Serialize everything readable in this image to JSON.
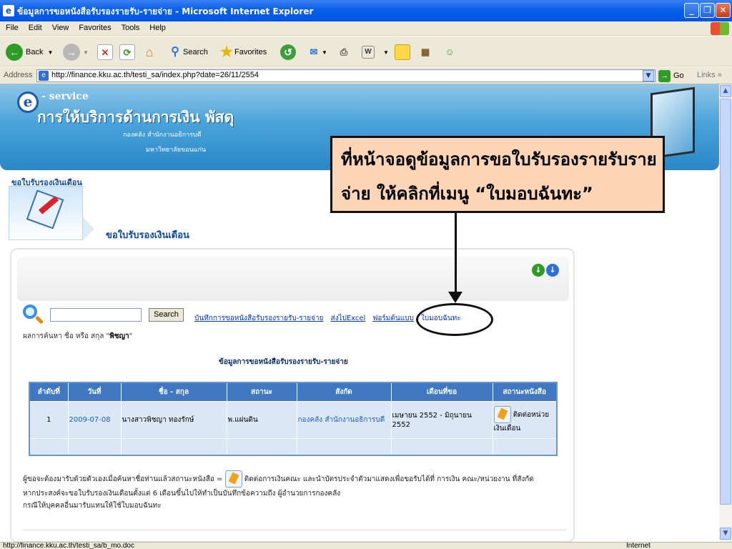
{
  "window": {
    "title": "ข้อมูลการขอหนังสือรับรองรายรับ-รายจ่าย - Microsoft Internet Explorer",
    "minimize": "_",
    "maximize": "❐",
    "close": "✕"
  },
  "menu": [
    "File",
    "Edit",
    "View",
    "Favorites",
    "Tools",
    "Help"
  ],
  "toolbar": {
    "back": "Back",
    "search": "Search",
    "favorites": "Favorites"
  },
  "address": {
    "label": "Address",
    "url": "http://finance.kku.ac.th/testi_sa/index.php?date=26/11/2554",
    "go": "Go",
    "links": "Links"
  },
  "banner": {
    "service": "- service",
    "title": "การให้บริการด้านการเงิน พัสดุ",
    "line2": "กองคลัง สำนักงานอธิการบดี",
    "line3": "มหาวิทยาลัยขอนแก่น"
  },
  "section": {
    "header": "ขอใบรับรองเงินเดือน",
    "subtitle": "ขอใบรับรองเงินเดือน"
  },
  "search": {
    "button": "Search",
    "value": ""
  },
  "links": {
    "record": "บันทึกการขอหนังสือรับรองรายรับ-รายจ่าย",
    "export": "ส่งไปExcel",
    "form": "ฟอร์มต้นแบบ",
    "proxy": "ใบมอบฉันทะ"
  },
  "result": {
    "prefix": "ผลการค้นหา ชื่อ หรือ สกุล \"",
    "name": "พิชญา",
    "suffix": "\""
  },
  "table": {
    "title": "ข้อมูลการขอหนังสือรับรองรายรับ-รายจ่าย",
    "headers": [
      "ลำดับที่",
      "วันที่",
      "ชื่อ - สกุล",
      "สถานะ",
      "สังกัด",
      "เดือนที่ขอ",
      "สถานะหนังสือ"
    ],
    "rows": [
      {
        "no": "1",
        "date": "2009-07-08",
        "name": "นางสาวพิชญา ทองรักษ์",
        "status": "พ.แผ่นดิน",
        "dept": "กองคลัง สำนักงานอธิการบดี",
        "months": "เมษายน 2552 - มิถุนายน 2552",
        "doc_status": "ติดต่อหน่วยเงินเดือน"
      }
    ]
  },
  "notes": {
    "line1a": "ผู้ขอจะต้องมารับด้วยตัวเองเมื่อค้นหาชื่อท่านแล้วสถานะหนังสือ =",
    "line1b": "ติดต่อการเงินคณะ และนำบัตรประจำตัวมาแสดงเพื่อขอรับได้ที่ การเงิน คณะ/หน่วยงาน ที่สังกัด",
    "line2": "หากประสงค์จะขอใบรับรองเงินเดือนตั้งแต่ 6 เดือนขึ้นไปให้ทำเป็นบันทึกข้อความถึง ผู้อำนวยการกองคลัง",
    "line3": "กรณีให้บุคคลอื่นมารับแทนให้ใช้ใบมอบฉันทะ"
  },
  "callout": {
    "text": "ที่หน้าจอดูข้อมูลการขอใบรับรองรายรับรายจ่าย  ให้คลิกที่เมนู “ใบมอบฉันทะ”"
  },
  "status": {
    "url": "http://finance.kku.ac.th/testi_sa/b_mo.doc",
    "zone": "Internet"
  }
}
